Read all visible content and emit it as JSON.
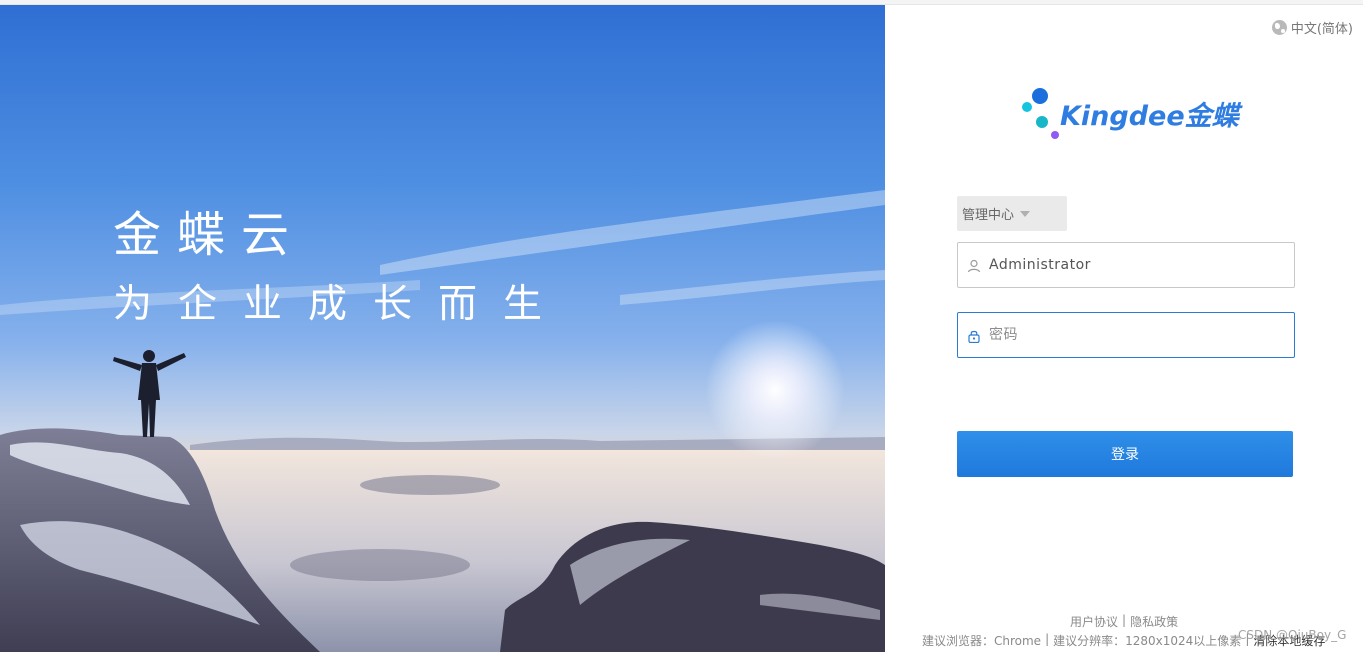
{
  "hero": {
    "title": "金蝶云",
    "subtitle": "为企业成长而生"
  },
  "lang": {
    "label": "中文(简体)",
    "icon": "globe-icon"
  },
  "logo": {
    "word": "Kingdee金蝶",
    "colors": [
      "#1b6fdc",
      "#17c4df",
      "#18b7c7",
      "#8e5cf0"
    ]
  },
  "center_select": {
    "label": "管理中心"
  },
  "username": {
    "value": "Administrator",
    "icon": "user-icon"
  },
  "password": {
    "placeholder": "密码",
    "icon": "lock-icon"
  },
  "login_button": {
    "label": "登录",
    "color": "#1f79dc"
  },
  "footer": {
    "user_agreement": "用户协议",
    "sep1": "|",
    "privacy": "隐私政策",
    "browser_tip": "建议浏览器：Chrome",
    "sep2": "|",
    "resolution_tip": "建议分辨率：1280x1024以上像素",
    "sep3": "|",
    "clear_cache": "清除本地缓存"
  },
  "watermark": "CSDN @QiuBoy_G"
}
